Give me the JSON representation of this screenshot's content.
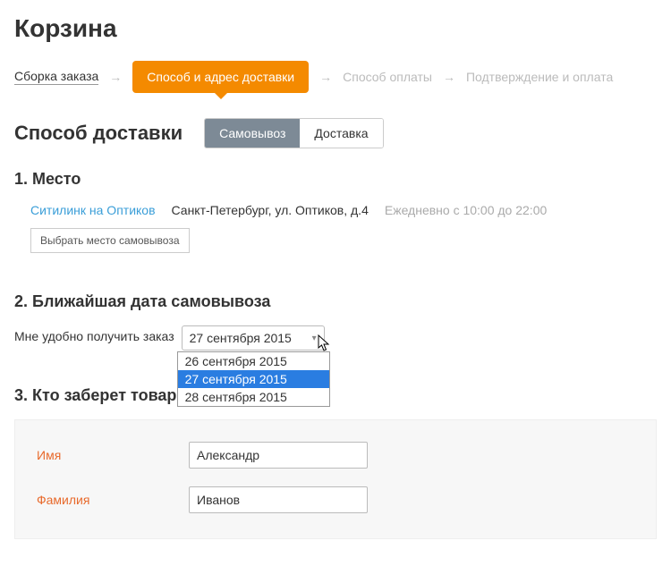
{
  "page_title": "Корзина",
  "steps": {
    "s1": "Сборка заказа",
    "s2": "Способ и адрес доставки",
    "s3": "Способ оплаты",
    "s4": "Подтверждение и оплата",
    "arrow": "→"
  },
  "delivery": {
    "heading": "Способ доставки",
    "opt_pickup": "Самовывоз",
    "opt_delivery": "Доставка"
  },
  "section1": {
    "heading": "1. Место",
    "store_link": "Ситилинк на Оптиков",
    "address": "Санкт-Петербург, ул. Оптиков, д.4",
    "hours": "Ежедневно с 10:00 до 22:00",
    "choose_btn": "Выбрать место самовывоза"
  },
  "section2": {
    "heading": "2. Ближайшая дата самовывоза",
    "label": "Мне удобно получить заказ",
    "selected": "27 сентября 2015",
    "options": [
      "26 сентября 2015",
      "27 сентября 2015",
      "28 сентября 2015"
    ]
  },
  "section3": {
    "heading": "3. Кто заберет товары",
    "name_label": "Имя",
    "name_value": "Александр",
    "surname_label": "Фамилия",
    "surname_value": "Иванов"
  }
}
